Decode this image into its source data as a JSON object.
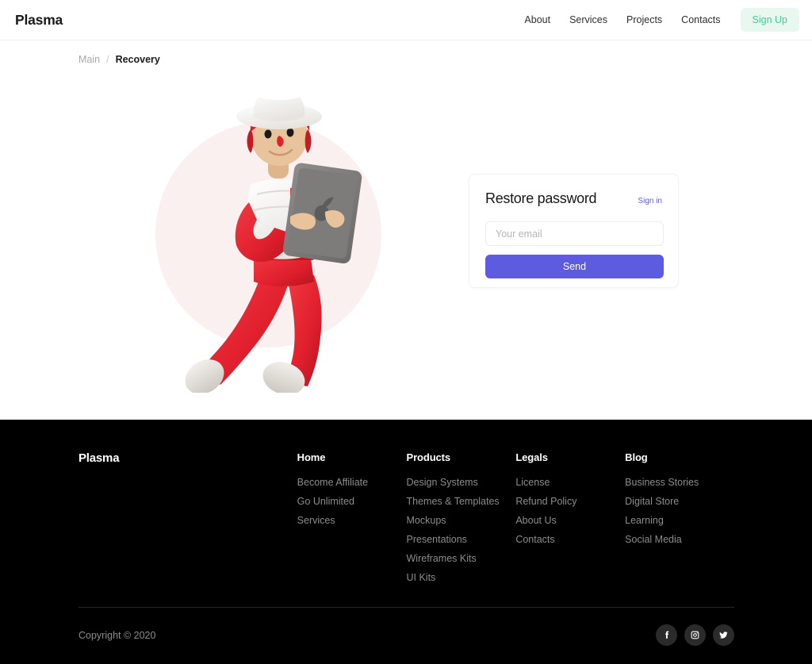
{
  "header": {
    "logo": "Plasma",
    "nav": [
      {
        "label": "About"
      },
      {
        "label": "Services"
      },
      {
        "label": "Projects"
      },
      {
        "label": "Contacts"
      }
    ],
    "signup_label": "Sign Up",
    "signup_bg": "#e8f8f1",
    "signup_color": "#4bc79a"
  },
  "breadcrumb": {
    "root": "Main",
    "separator": "/",
    "current": "Recovery"
  },
  "illustration": {
    "name": "person-floating-with-tablet-illustration",
    "circle_color": "#fbf0f0",
    "alt": "3D character in white hat and red outfit holding a tablet"
  },
  "card": {
    "title": "Restore password",
    "sign_in_label": "Sign in",
    "sign_in_color": "#5d5be0",
    "email_placeholder": "Your email",
    "email_value": "",
    "send_label": "Send",
    "send_bg": "#5d5be0"
  },
  "footer": {
    "brand": "Plasma",
    "background": "#000000",
    "columns": [
      {
        "title": "Home",
        "links": [
          "Become Affiliate",
          "Go Unlimited",
          "Services"
        ]
      },
      {
        "title": "Products",
        "links": [
          "Design Systems",
          "Themes & Templates",
          "Mockups",
          "Presentations",
          "Wireframes Kits",
          "UI Kits"
        ]
      },
      {
        "title": "Legals",
        "links": [
          "License",
          "Refund Policy",
          "About Us",
          "Contacts"
        ]
      },
      {
        "title": "Blog",
        "links": [
          "Business Stories",
          "Digital Store",
          "Learning",
          "Social Media"
        ]
      }
    ],
    "copyright": "Copyright © 2020",
    "socials": [
      {
        "name": "facebook-icon"
      },
      {
        "name": "instagram-icon"
      },
      {
        "name": "twitter-icon"
      }
    ]
  }
}
